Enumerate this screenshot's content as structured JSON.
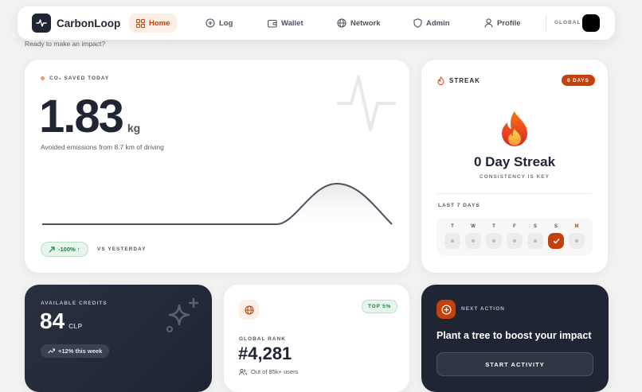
{
  "nav": {
    "logo": "CarbonLoop",
    "items": [
      {
        "label": "Home",
        "icon": "grid-icon",
        "active": true
      },
      {
        "label": "Log",
        "icon": "plus-circle-icon"
      },
      {
        "label": "Wallet",
        "icon": "wallet-icon"
      },
      {
        "label": "Network",
        "icon": "globe-icon"
      },
      {
        "label": "Admin",
        "icon": "shield-icon"
      },
      {
        "label": "Profile",
        "icon": "user-icon"
      }
    ],
    "scope": "GLOBAL"
  },
  "greeting": "Ready to make an impact?",
  "co2": {
    "label": "CO₂ SAVED TODAY",
    "value": "1.83",
    "unit": "kg",
    "desc": "Avoided emissions from 8.7 km of driving",
    "change": "-100% ↑",
    "change_suffix": "VS YESTERDAY"
  },
  "streak": {
    "label": "STREAK",
    "badge": "0 DAYS",
    "title": "0 Day Streak",
    "subtitle": "CONSISTENCY IS KEY",
    "week_label": "LAST 7 DAYS",
    "days": [
      {
        "d": "T",
        "done": false
      },
      {
        "d": "W",
        "done": false
      },
      {
        "d": "T",
        "done": false
      },
      {
        "d": "F",
        "done": false
      },
      {
        "d": "S",
        "done": false
      },
      {
        "d": "S",
        "done": true
      },
      {
        "d": "M",
        "done": false,
        "highlight": true
      }
    ]
  },
  "credits": {
    "label": "AVAILABLE CREDITS",
    "value": "84",
    "unit": "CLP",
    "change": "+12% this week"
  },
  "rank": {
    "badge": "TOP 5%",
    "label": "GLOBAL RANK",
    "value": "#4,281",
    "sub": "Out of 85k+ users"
  },
  "next_action": {
    "label": "NEXT ACTION",
    "title": "Plant a tree to boost your impact",
    "button": "START ACTIVITY"
  },
  "colors": {
    "accent": "#c2410c",
    "dark": "#1f2533",
    "green": "#1f7a45"
  }
}
